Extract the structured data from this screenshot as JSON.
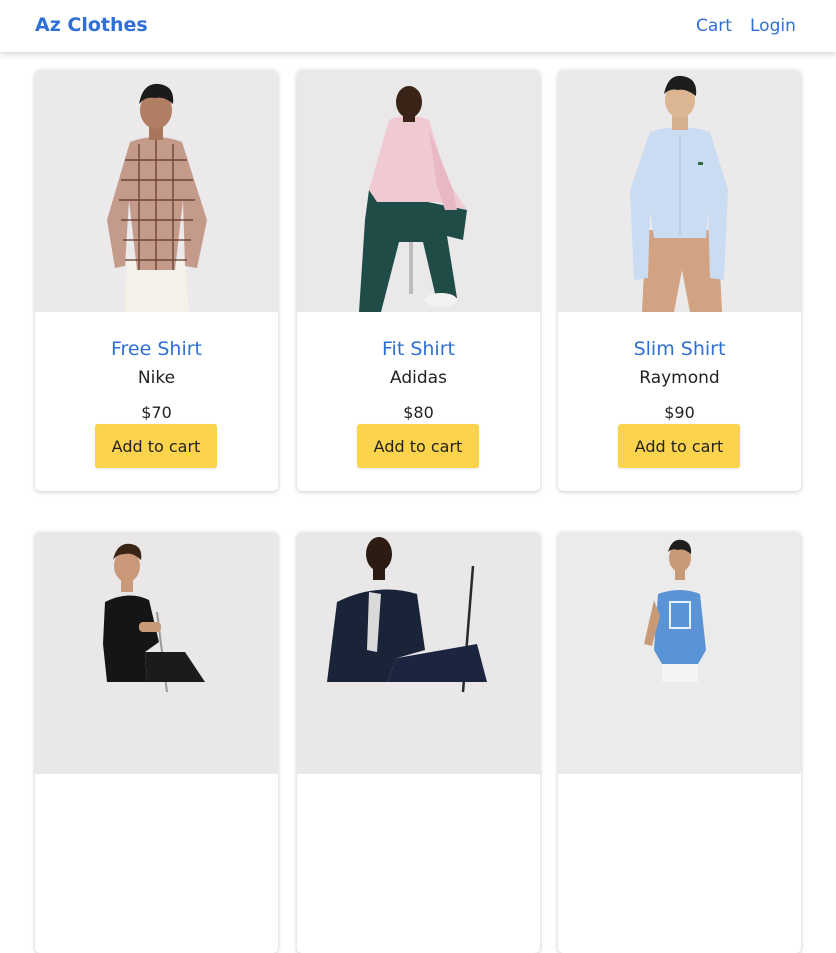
{
  "navbar": {
    "brand": "Az Clothes",
    "links": {
      "cart": "Cart",
      "login": "Login"
    }
  },
  "products": [
    {
      "name": "Free Shirt",
      "brand": "Nike",
      "price": "$70",
      "add_label": "Add to cart"
    },
    {
      "name": "Fit Shirt",
      "brand": "Adidas",
      "price": "$80",
      "add_label": "Add to cart"
    },
    {
      "name": "Slim Shirt",
      "brand": "Raymond",
      "price": "$90",
      "add_label": "Add to cart"
    },
    {
      "name": "",
      "brand": "",
      "price": "",
      "add_label": ""
    },
    {
      "name": "",
      "brand": "",
      "price": "",
      "add_label": ""
    },
    {
      "name": "",
      "brand": "",
      "price": "",
      "add_label": ""
    }
  ],
  "colors": {
    "accent": "#2f6fd6",
    "button": "#fcd34d",
    "photo_bg": "#eceaeb"
  }
}
